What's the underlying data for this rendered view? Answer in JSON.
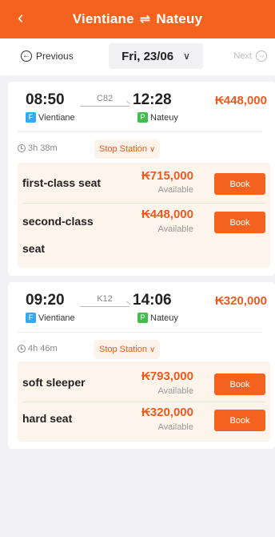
{
  "header": {
    "back_icon": "‹",
    "origin": "Vientiane",
    "swap_icon": "⇌",
    "destination": "Nateuy"
  },
  "datebar": {
    "prev_label": "Previous",
    "prev_icon": "←",
    "date": "Fri, 23/06",
    "date_chevron": "∨",
    "next_label": "Next",
    "next_icon": "→"
  },
  "trains": [
    {
      "departure": "08:50",
      "arrival": "12:28",
      "code": "C82",
      "price": "₭448,000",
      "from_tag": "F",
      "from": "Vientiane",
      "to_tag": "P",
      "to": "Nateuy",
      "duration": "3h 38m",
      "stop_label": "Stop Station",
      "stop_chevron": "∨",
      "seats": [
        {
          "name": "first-class seat",
          "price": "₭715,000",
          "status": "Available",
          "book": "Book"
        },
        {
          "name": "second-class",
          "name2": "seat",
          "price": "₭448,000",
          "status": "Available",
          "book": "Book"
        }
      ]
    },
    {
      "departure": "09:20",
      "arrival": "14:06",
      "code": "K12",
      "price": "₭320,000",
      "from_tag": "F",
      "from": "Vientiane",
      "to_tag": "P",
      "to": "Nateuy",
      "duration": "4h 46m",
      "stop_label": "Stop Station",
      "stop_chevron": "∨",
      "seats": [
        {
          "name": "soft sleeper",
          "price": "₭793,000",
          "status": "Available",
          "book": "Book"
        },
        {
          "name": "hard seat",
          "price": "₭320,000",
          "status": "Available",
          "book": "Book"
        }
      ]
    }
  ],
  "colors": {
    "accent": "#f4621f",
    "price": "#ef5a1d",
    "from_tag": "#35aaf4",
    "to_tag": "#3fbf4a"
  }
}
